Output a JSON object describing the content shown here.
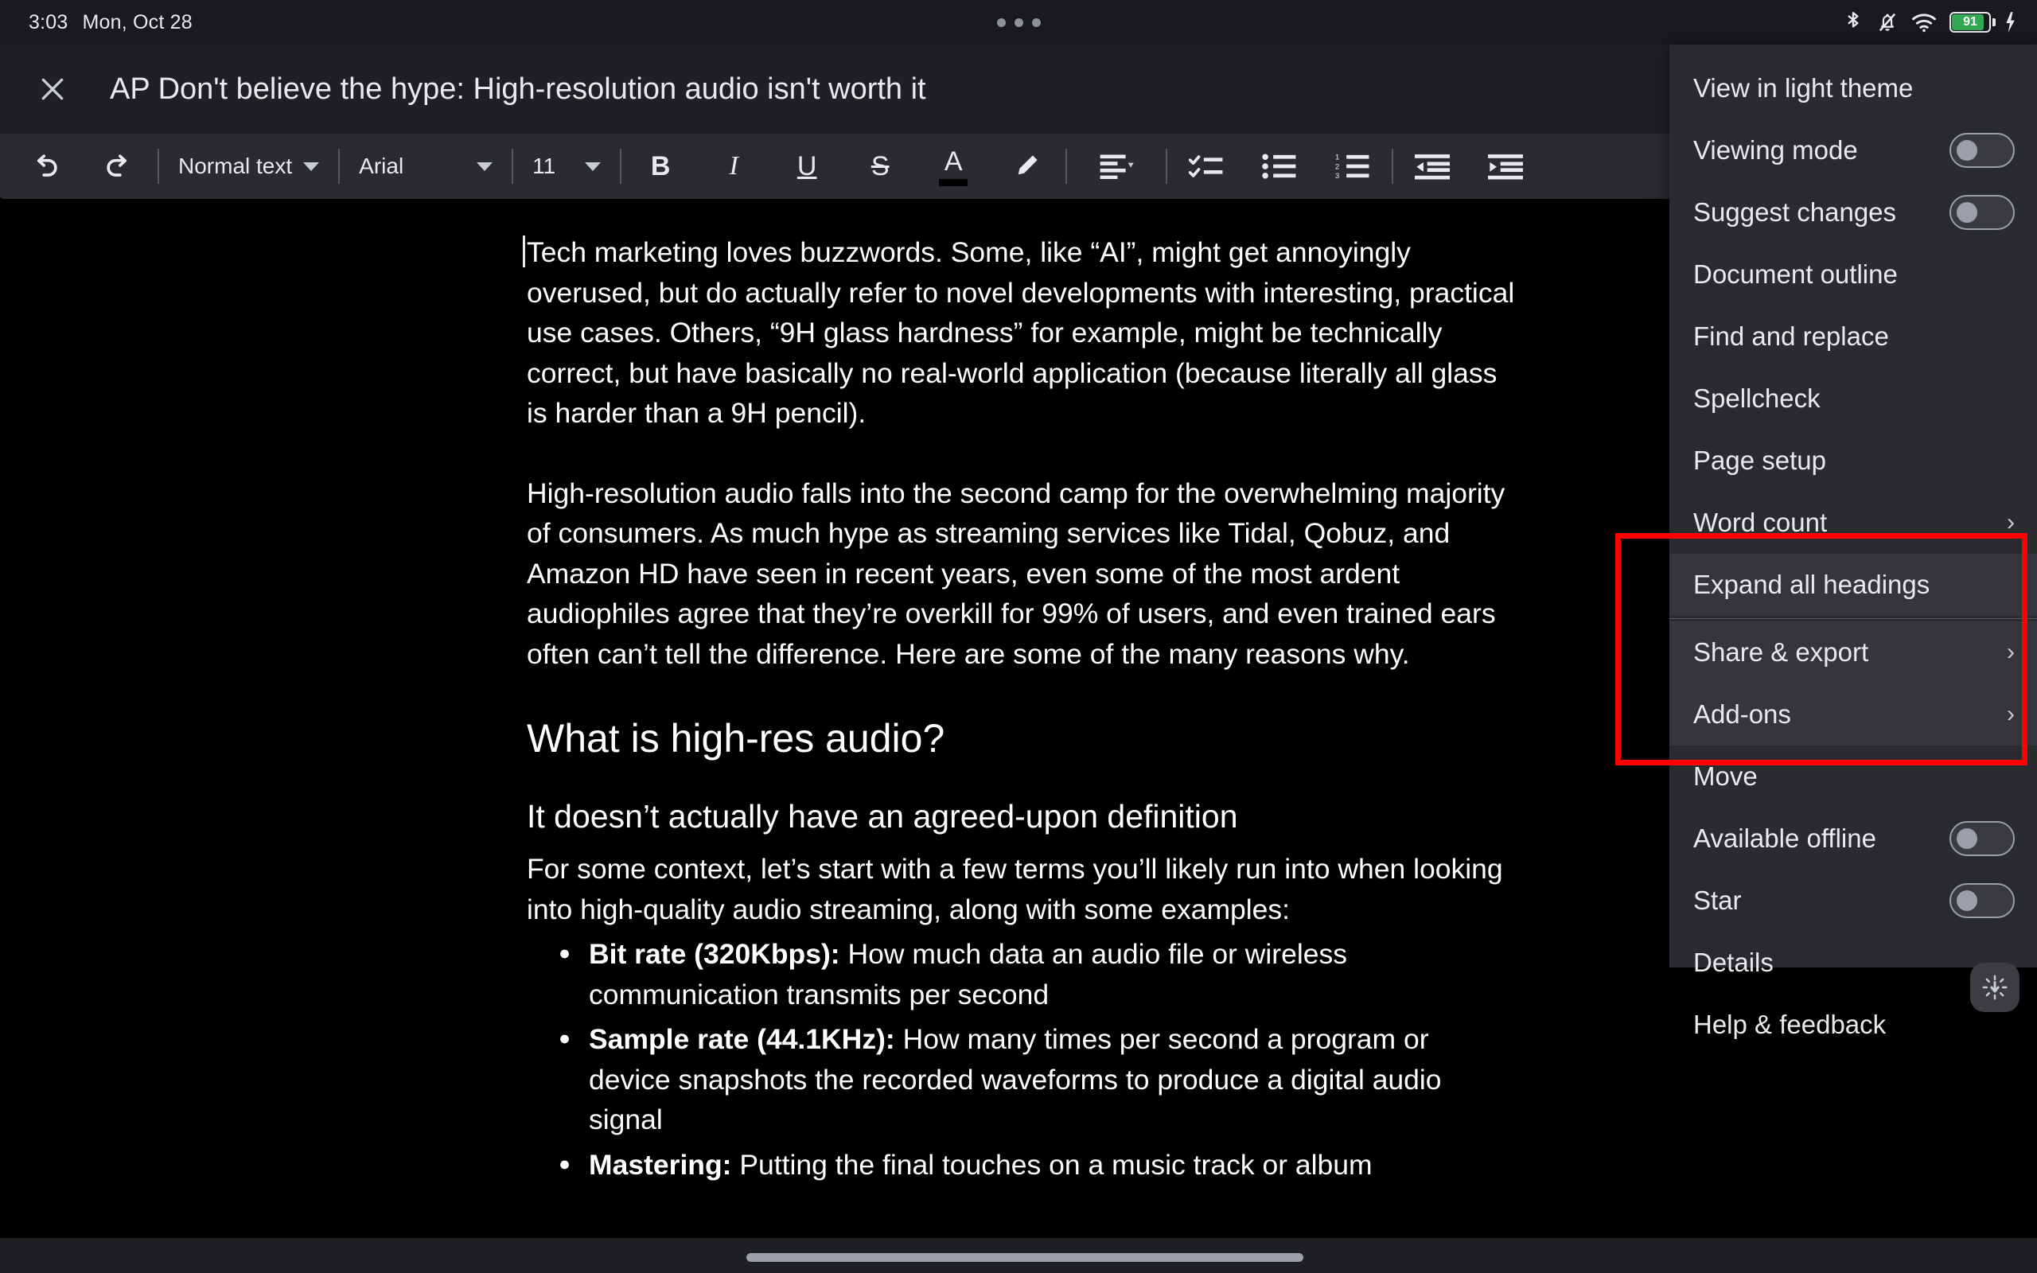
{
  "status_bar": {
    "time": "3:03",
    "date": "Mon, Oct 28",
    "icons": [
      "bluetooth-icon",
      "notifications-muted-icon",
      "wifi-icon",
      "battery-icon",
      "charging-bolt-icon"
    ],
    "battery_percent": "91",
    "overflow_indicator": "three-dots-indicator"
  },
  "header": {
    "close_label": "×",
    "title": "AP Don't believe the hype: High-resolution audio isn't worth it",
    "share_button_label": "",
    "avatar_label": ""
  },
  "toolbar": {
    "undo": "undo-icon",
    "redo": "redo-icon",
    "style_label": "Normal text",
    "font_label": "Arial",
    "size_label": "11",
    "bold_label": "B",
    "italic_label": "I",
    "underline_label": "U",
    "strikethrough_label": "S",
    "text_color_label": "A",
    "highlight_label": "highlight-pen-icon",
    "align_label": "align-left-icon",
    "checklist_label": "checklist-icon",
    "bulleted_label": "bulleted-list-icon",
    "numbered_label": "numbered-list-icon",
    "decrease_indent_label": "decrease-indent-icon",
    "increase_indent_label": "increase-indent-icon"
  },
  "document": {
    "paragraph_1": "Tech marketing loves buzzwords. Some, like “AI”, might get annoyingly overused, but do actually refer to novel developments with interesting, practical use cases. Others, “9H glass hardness” for example, might be technically correct, but have basically no real-world application (because literally all glass is harder than a 9H pencil).",
    "paragraph_2": "High-resolution audio falls into the second camp for the overwhelming majority of consumers. As much hype as streaming services like Tidal, Qobuz, and Amazon HD have seen in recent years, even some of the most ardent audiophiles agree that they’re overkill for 99% of users, and even trained ears often can’t tell the difference. Here are some of the many reasons why.",
    "heading_1": "What is high-res audio?",
    "heading_2": "It doesn’t actually have an agreed-upon definition",
    "paragraph_3": "For some context, let’s start with a few terms you’ll likely run into when looking into high-quality audio streaming, along with some examples:",
    "bullets": [
      {
        "term": "Bit rate (320Kbps):",
        "text": " How much data an audio file or wireless communication transmits per second"
      },
      {
        "term": "Sample rate (44.1KHz):",
        "text": " How many times per second a program or device snapshots the recorded waveforms to produce a digital audio signal"
      },
      {
        "term": "Mastering:",
        "text": " Putting the final touches on a music track or album"
      }
    ]
  },
  "menu": {
    "items": [
      {
        "label": "View in light theme",
        "type": "plain"
      },
      {
        "label": "Viewing mode",
        "type": "toggle",
        "value": "off"
      },
      {
        "label": "Suggest changes",
        "type": "toggle",
        "value": "off"
      },
      {
        "label": "Document outline",
        "type": "plain"
      },
      {
        "label": "Find and replace",
        "type": "plain"
      },
      {
        "label": "Spellcheck",
        "type": "plain"
      },
      {
        "label": "Page setup",
        "type": "plain"
      },
      {
        "label": "Word count",
        "type": "submenu"
      },
      {
        "label": "Expand all headings",
        "type": "plain",
        "highlighted": true
      },
      {
        "label": "Share & export",
        "type": "submenu",
        "highlighted": true
      },
      {
        "label": "Add-ons",
        "type": "submenu",
        "highlighted": true
      },
      {
        "label": "Move",
        "type": "plain"
      },
      {
        "label": "Available offline",
        "type": "toggle",
        "value": "off"
      },
      {
        "label": "Star",
        "type": "toggle",
        "value": "off"
      },
      {
        "label": "Details",
        "type": "plain"
      },
      {
        "label": "Help & feedback",
        "type": "plain"
      }
    ],
    "chevron_glyph": "›"
  },
  "annotation": {
    "highlight_color": "#ff0000"
  },
  "floating": {
    "brightness_button": "brightness-down-icon"
  },
  "scrollbar": {
    "orientation": "horizontal"
  }
}
